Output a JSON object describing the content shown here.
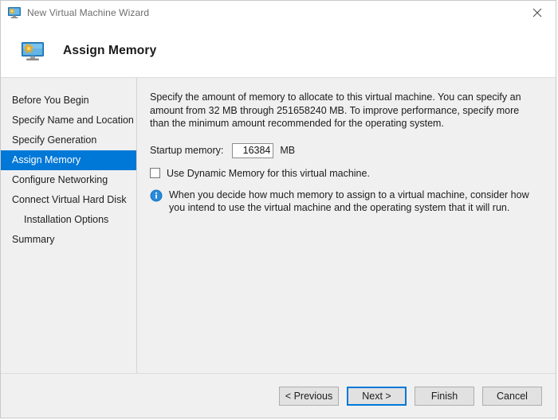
{
  "window": {
    "title": "New Virtual Machine Wizard",
    "icon": "virtual-machine-icon",
    "close_icon": "close-icon"
  },
  "header": {
    "title": "Assign Memory",
    "icon": "virtual-machine-icon"
  },
  "sidebar": {
    "items": [
      {
        "label": "Before You Begin",
        "selected": false,
        "indented": false
      },
      {
        "label": "Specify Name and Location",
        "selected": false,
        "indented": false
      },
      {
        "label": "Specify Generation",
        "selected": false,
        "indented": false
      },
      {
        "label": "Assign Memory",
        "selected": true,
        "indented": false
      },
      {
        "label": "Configure Networking",
        "selected": false,
        "indented": false
      },
      {
        "label": "Connect Virtual Hard Disk",
        "selected": false,
        "indented": false
      },
      {
        "label": "Installation Options",
        "selected": false,
        "indented": true
      },
      {
        "label": "Summary",
        "selected": false,
        "indented": false
      }
    ]
  },
  "main": {
    "intro_text": "Specify the amount of memory to allocate to this virtual machine. You can specify an amount from 32 MB through 251658240 MB. To improve performance, specify more than the minimum amount recommended for the operating system.",
    "memory_label": "Startup memory:",
    "memory_value": "16384",
    "memory_unit": "MB",
    "dynamic_memory_label": "Use Dynamic Memory for this virtual machine.",
    "dynamic_memory_checked": false,
    "info_icon": "info-icon",
    "info_text": "When you decide how much memory to assign to a virtual machine, consider how you intend to use the virtual machine and the operating system that it will run."
  },
  "footer": {
    "previous_label": "< Previous",
    "next_label": "Next >",
    "finish_label": "Finish",
    "cancel_label": "Cancel"
  },
  "colors": {
    "accent": "#0078d7",
    "window_bg": "#f0f0f0",
    "panel_bg": "#ffffff",
    "info_blue": "#1878c8"
  }
}
